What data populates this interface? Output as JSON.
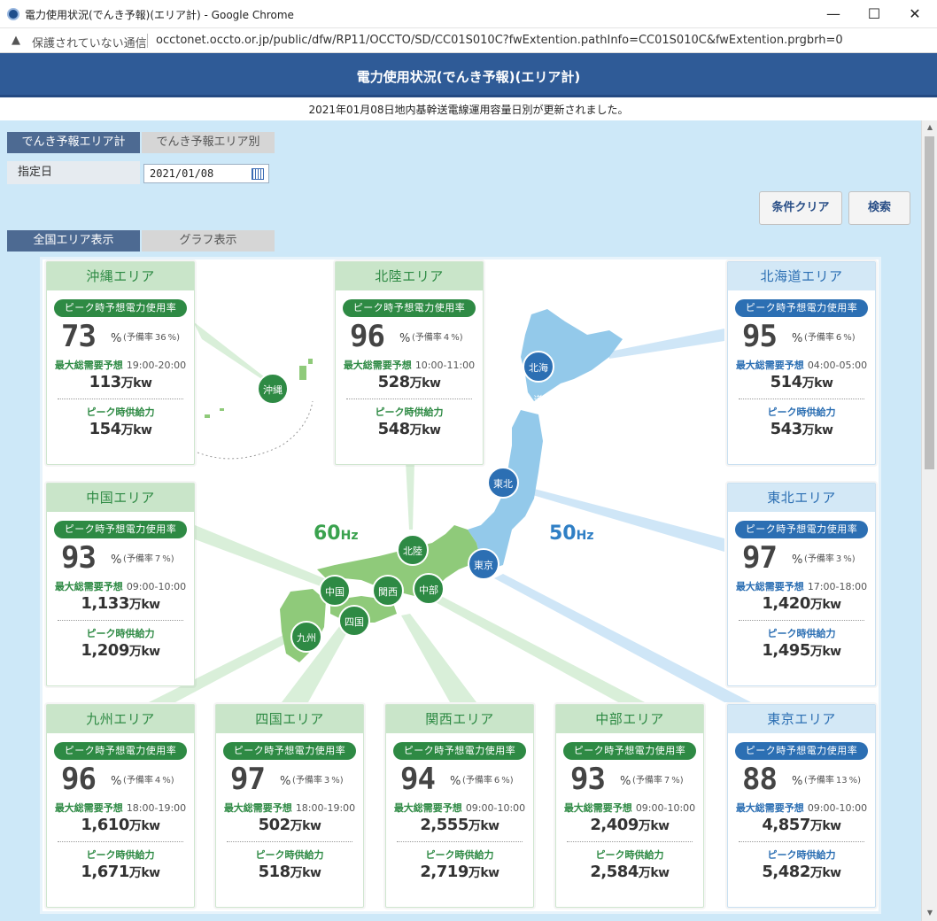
{
  "window": {
    "title": "電力使用状況(でんき予報)(エリア計) - Google Chrome",
    "minimize_icon": "minimize-icon",
    "maximize_icon": "maximize-icon",
    "close_icon": "close-icon"
  },
  "address": {
    "security_label": "保護されていない通信",
    "url": "occtonet.occto.or.jp/public/dfw/RP11/OCCTO/SD/CC01S010C?fwExtention.pathInfo=CC01S010C&fwExtention.prgbrh=0"
  },
  "page": {
    "title": "電力使用状況(でんき予報)(エリア計)",
    "notice": "2021年01月08日地内基幹送電線運用容量日別が更新されました。"
  },
  "tabs": {
    "area_total": "でんき予報エリア計",
    "area_each": "でんき予報エリア別"
  },
  "date_field": {
    "label": "指定日",
    "value": "2021/01/08"
  },
  "buttons": {
    "clear": "条件クリア",
    "search": "検索"
  },
  "view_tabs": {
    "map": "全国エリア表示",
    "graph": "グラフ表示"
  },
  "labels": {
    "rate_pill": "ピーク時予想電力使用率",
    "percent": "%",
    "reserve_prefix": "(予備率",
    "reserve_suffix": "%)",
    "demand": "最大総需要予想",
    "supply": "ピーク時供給力",
    "unit": "万kw"
  },
  "hz": {
    "west_value": "60",
    "west_unit": "Hz",
    "east_value": "50",
    "east_unit": "Hz"
  },
  "markers": {
    "okinawa": "沖縄",
    "hokkaido": "北海道",
    "tohoku": "東北",
    "tokyo": "東京",
    "hokuriku": "北陸",
    "chugoku": "中国",
    "kansai": "関西",
    "chubu": "中部",
    "shikoku": "四国",
    "kyushu": "九州"
  },
  "areas": {
    "okinawa": {
      "name": "沖縄エリア",
      "rate": "73",
      "reserve": "36",
      "demand_time": "19:00-20:00",
      "demand": "113",
      "supply": "154"
    },
    "hokuriku": {
      "name": "北陸エリア",
      "rate": "96",
      "reserve": "4",
      "demand_time": "10:00-11:00",
      "demand": "528",
      "supply": "548"
    },
    "hokkaido": {
      "name": "北海道エリア",
      "rate": "95",
      "reserve": "6",
      "demand_time": "04:00-05:00",
      "demand": "514",
      "supply": "543"
    },
    "chugoku": {
      "name": "中国エリア",
      "rate": "93",
      "reserve": "7",
      "demand_time": "09:00-10:00",
      "demand": "1,133",
      "supply": "1,209"
    },
    "tohoku": {
      "name": "東北エリア",
      "rate": "97",
      "reserve": "3",
      "demand_time": "17:00-18:00",
      "demand": "1,420",
      "supply": "1,495"
    },
    "kyushu": {
      "name": "九州エリア",
      "rate": "96",
      "reserve": "4",
      "demand_time": "18:00-19:00",
      "demand": "1,610",
      "supply": "1,671"
    },
    "shikoku": {
      "name": "四国エリア",
      "rate": "97",
      "reserve": "3",
      "demand_time": "18:00-19:00",
      "demand": "502",
      "supply": "518"
    },
    "kansai": {
      "name": "関西エリア",
      "rate": "94",
      "reserve": "6",
      "demand_time": "09:00-10:00",
      "demand": "2,555",
      "supply": "2,719"
    },
    "chubu": {
      "name": "中部エリア",
      "rate": "93",
      "reserve": "7",
      "demand_time": "09:00-10:00",
      "demand": "2,409",
      "supply": "2,584"
    },
    "tokyo": {
      "name": "東京エリア",
      "rate": "88",
      "reserve": "13",
      "demand_time": "09:00-10:00",
      "demand": "4,857",
      "supply": "5,482"
    }
  },
  "colors": {
    "header_blue": "#2f5b97",
    "west_green": "#2e8a44",
    "east_blue": "#2c6fb3",
    "background": "#cde8f8"
  }
}
